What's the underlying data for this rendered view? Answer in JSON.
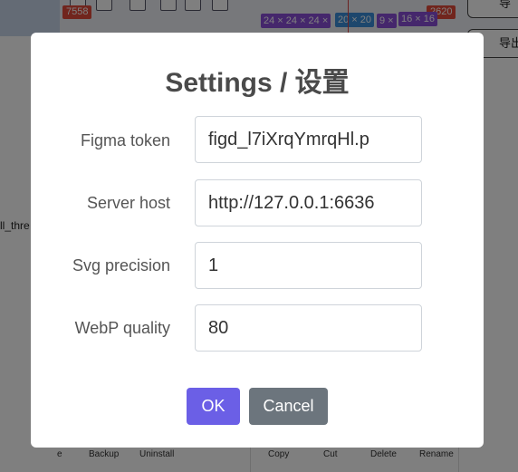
{
  "background": {
    "badges": {
      "left_count": "7558",
      "right_count": "2620"
    },
    "size_tags": [
      "24 × 24 × 24 ×",
      "20 × 20",
      "9 ×",
      "16 × 16"
    ],
    "right_buttons": [
      "导",
      "导出"
    ],
    "side_label": "ll_thre",
    "bottom_left_actions": [
      "e",
      "Backup",
      "Uninstall"
    ],
    "bottom_right_actions": [
      "Copy",
      "Cut",
      "Delete",
      "Rename"
    ]
  },
  "dialog": {
    "title": "Settings / 设置",
    "fields": {
      "figma_token": {
        "label": "Figma token",
        "value": "figd_l7iXrqYmrqHl.p"
      },
      "server_host": {
        "label": "Server host",
        "value": "http://127.0.0.1:6636"
      },
      "svg_precision": {
        "label": "Svg precision",
        "value": "1"
      },
      "webp_quality": {
        "label": "WebP quality",
        "value": "80"
      }
    },
    "ok_label": "OK",
    "cancel_label": "Cancel"
  },
  "colors": {
    "overlay": "rgba(0,0,0,0.5)",
    "ok_button": "#6b5fe6",
    "cancel_button": "#6c757d",
    "badge_red": "#e24a3b",
    "tag_purple": "#8a4fd9",
    "guide_line": "#d64545"
  },
  "icons": [
    "toolbar-tool-icon"
  ]
}
